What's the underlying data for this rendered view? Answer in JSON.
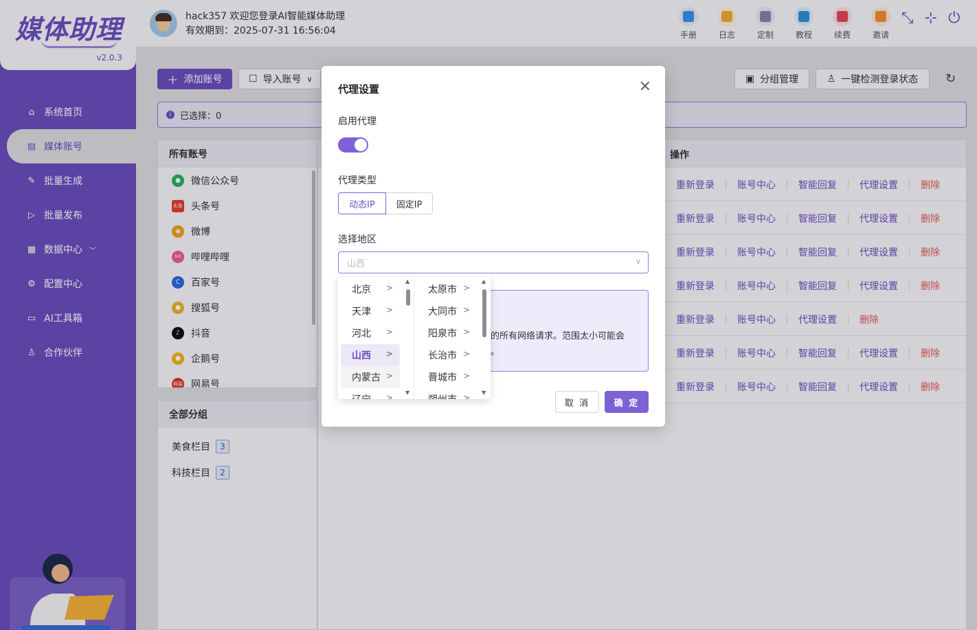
{
  "app": {
    "logo_text": "媒体助理",
    "version": "v2.0.3"
  },
  "header": {
    "greeting": "hack357 欢迎您登录AI智能媒体助理",
    "expire": "有效期到：2025-07-31 16:56:04",
    "tools": [
      {
        "label": "手册",
        "icon": "manual-icon",
        "color": "#3a8ee6"
      },
      {
        "label": "日志",
        "icon": "log-icon",
        "color": "#f0a93b"
      },
      {
        "label": "定制",
        "icon": "custom-icon",
        "color": "#8b7fb0"
      },
      {
        "label": "教程",
        "icon": "tutorial-icon",
        "color": "#2f8fd8"
      },
      {
        "label": "续费",
        "icon": "renew-icon",
        "color": "#e0475a"
      },
      {
        "label": "邀请",
        "icon": "invite-icon",
        "color": "#f08c3a"
      }
    ]
  },
  "sidebar": {
    "items": [
      {
        "label": "系统首页",
        "icon": "home-icon"
      },
      {
        "label": "媒体账号",
        "icon": "account-icon",
        "active": true
      },
      {
        "label": "批量生成",
        "icon": "edit-icon"
      },
      {
        "label": "批量发布",
        "icon": "send-icon"
      },
      {
        "label": "数据中心",
        "icon": "data-icon"
      },
      {
        "label": "配置中心",
        "icon": "settings-icon"
      },
      {
        "label": "AI工具箱",
        "icon": "toolbox-icon"
      },
      {
        "label": "合作伙伴",
        "icon": "partner-icon"
      }
    ]
  },
  "toolbar": {
    "add": "添加账号",
    "import": "导入账号",
    "group_manage": "分组管理",
    "check_login": "一键检测登录状态",
    "selected": "已选择：0"
  },
  "accounts_panel": {
    "title": "所有账号",
    "platforms": [
      {
        "label": "微信公众号",
        "color": "#2aae67",
        "glyph": "●"
      },
      {
        "label": "头条号",
        "color": "#e33e33",
        "glyph": "头条"
      },
      {
        "label": "微博",
        "color": "#f0a020",
        "glyph": "◉"
      },
      {
        "label": "哔哩哔哩",
        "color": "#f25d8e",
        "glyph": "bili"
      },
      {
        "label": "百家号",
        "color": "#2f66e0",
        "glyph": "C"
      },
      {
        "label": "搜狐号",
        "color": "#e8b52a",
        "glyph": "●"
      },
      {
        "label": "抖音",
        "color": "#111111",
        "glyph": "♪"
      },
      {
        "label": "企鹅号",
        "color": "#f2b518",
        "glyph": "●"
      },
      {
        "label": "网易号",
        "color": "#d8352a",
        "glyph": "网易"
      }
    ]
  },
  "groups_panel": {
    "title": "全部分组",
    "groups": [
      {
        "label": "美食栏目",
        "count": "3"
      },
      {
        "label": "科技栏目",
        "count": "2"
      }
    ]
  },
  "table": {
    "op_header": "操作",
    "rows": [
      [
        "重新登录",
        "账号中心",
        "智能回复",
        "代理设置",
        "删除"
      ],
      [
        "重新登录",
        "账号中心",
        "智能回复",
        "代理设置",
        "删除"
      ],
      [
        "重新登录",
        "账号中心",
        "智能回复",
        "代理设置",
        "删除"
      ],
      [
        "重新登录",
        "账号中心",
        "智能回复",
        "代理设置",
        "删除"
      ],
      [
        "重新登录",
        "账号中心",
        "代理设置",
        "删除"
      ],
      [
        "重新登录",
        "账号中心",
        "智能回复",
        "代理设置",
        "删除"
      ],
      [
        "重新登录",
        "账号中心",
        "智能回复",
        "代理设置",
        "删除"
      ]
    ]
  },
  "modal": {
    "title": "代理设置",
    "enable_label": "启用代理",
    "enabled": true,
    "type_label": "代理类型",
    "type_options": [
      "动态IP",
      "固定IP"
    ],
    "type_selected": "动态IP",
    "region_label": "选择地区",
    "region_placeholder": "山西",
    "alert_line1": "的所有网络请求。范围太小可能会",
    "alert_line2": "。",
    "cancel": "取 消",
    "ok": "确 定"
  },
  "cascader": {
    "provinces": [
      "北京",
      "天津",
      "河北",
      "山西",
      "内蒙古",
      "辽宁"
    ],
    "selected_province": "山西",
    "hover_province": "内蒙古",
    "cities": [
      "太原市",
      "大同市",
      "阳泉市",
      "长治市",
      "晋城市",
      "朔州市"
    ]
  }
}
